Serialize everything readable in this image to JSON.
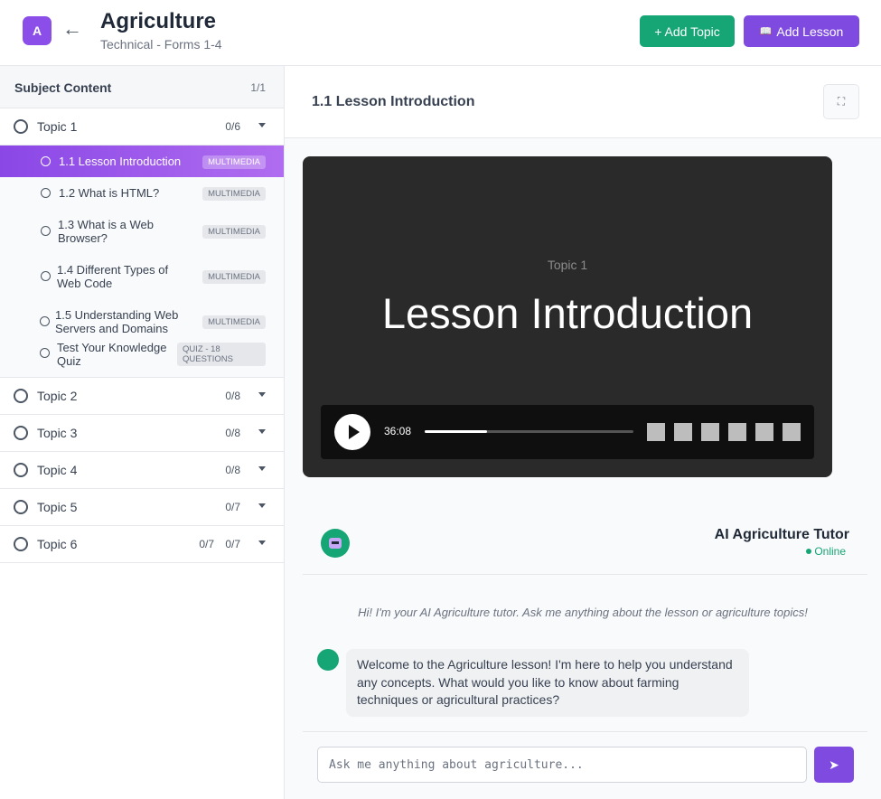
{
  "header": {
    "logo_letter": "A",
    "back_glyph": "←",
    "title": "Agriculture",
    "subtitle": "Technical - Forms 1-4",
    "add_topic_label": "+ Add Topic",
    "add_lesson_icon": "📖",
    "add_lesson_label": "Add Lesson"
  },
  "sidebar": {
    "title": "Subject Content",
    "count": "1/1",
    "topics": [
      {
        "name": "Topic 1",
        "count": "0/6",
        "expanded": true
      },
      {
        "name": "Topic 2",
        "count": "0/8"
      },
      {
        "name": "Topic 3",
        "count": "0/8"
      },
      {
        "name": "Topic 4",
        "count": "0/8"
      },
      {
        "name": "Topic 5",
        "count": "0/7"
      },
      {
        "name": "Topic 6",
        "count": "0/7",
        "count_extra": "0/7"
      }
    ],
    "lessons": [
      {
        "label": "1.1 Lesson Introduction",
        "tag": "MULTIMEDIA",
        "active": true
      },
      {
        "label": "1.2 What is HTML?",
        "tag": "MULTIMEDIA"
      },
      {
        "label": "1.3 What is a Web Browser?",
        "tag": "MULTIMEDIA"
      },
      {
        "label": "1.4 Different Types of Web Code",
        "tag": "MULTIMEDIA"
      },
      {
        "label": "1.5 Understanding Web Servers and Domains",
        "tag": "MULTIMEDIA"
      },
      {
        "label": "Test Your Knowledge Quiz",
        "tag": "QUIZ - 18 QUESTIONS"
      }
    ]
  },
  "main": {
    "lesson_title": "1.1 Lesson Introduction",
    "fullscreen_icon": "⛶",
    "video": {
      "topic_label": "Topic 1",
      "title": "Lesson Introduction",
      "time": "36:08",
      "progress_fraction": 0.3,
      "control_buttons": 6
    },
    "tutor": {
      "name": "AI Agriculture Tutor",
      "status": "Online",
      "status_color": "#16a574",
      "greeting": "Hi! I'm your AI Agriculture tutor. Ask me anything about the lesson or agriculture topics!",
      "message": "Welcome to the Agriculture lesson! I'm here to help you understand any concepts. What would you like to know about farming techniques or agricultural practices?"
    },
    "chat": {
      "placeholder": "Ask me anything about agriculture...",
      "send_icon": "➤"
    }
  },
  "colors": {
    "accent_purple": "#7f4ae0",
    "accent_green": "#16a574"
  }
}
